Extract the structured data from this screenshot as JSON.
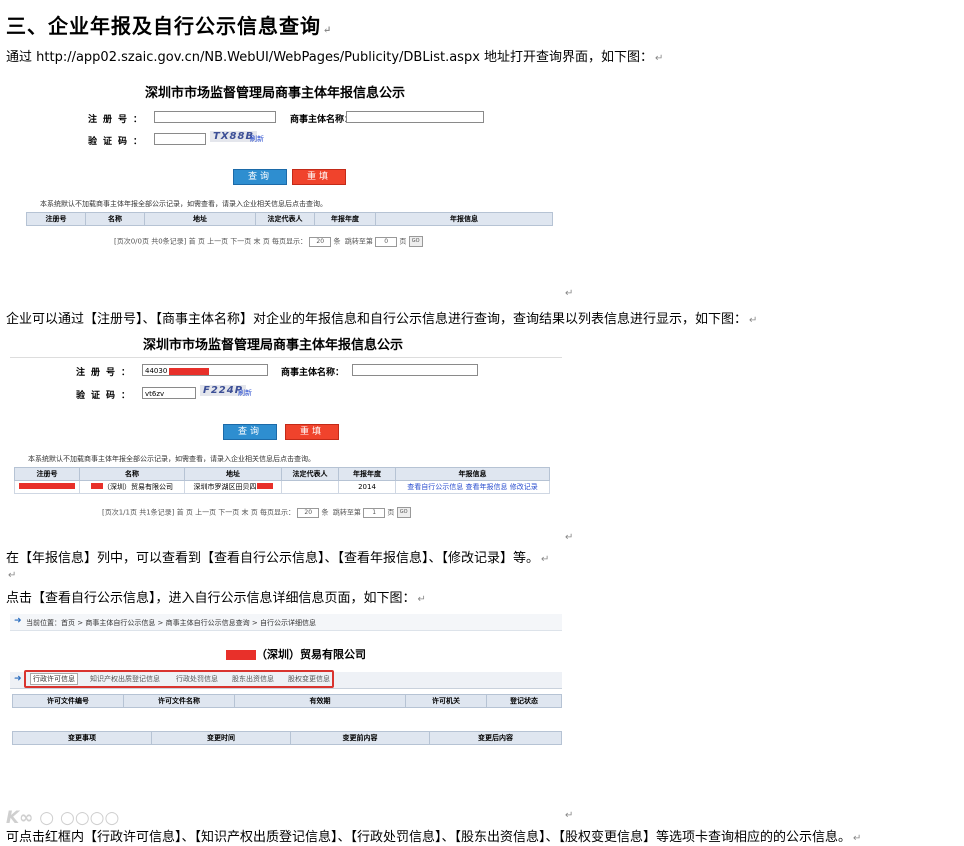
{
  "heading": "三、企业年报及自行公示信息查询",
  "para1": "通过 http://app02.szaic.gov.cn/NB.WebUI/WebPages/Publicity/DBList.aspx 地址打开查询界面，如下图：",
  "para2": "企业可以通过【注册号】、【商事主体名称】对企业的年报信息和自行公示信息进行查询，查询结果以列表信息进行显示，如下图：",
  "para3": "在【年报信息】列中，可以查看到【查看自行公示信息】、【查看年报信息】、【修改记录】等。",
  "para4": "点击【查看自行公示信息】，进入自行公示信息详细信息页面，如下图：",
  "para5": "可点击红框内【行政许可信息】、【知识产权出质登记信息】、【行政处罚信息】、【股东出资信息】、【股权变更信息】等选项卡查询相应的的公示信息。",
  "return_mark": "↵",
  "shot1": {
    "title": "深圳市市场监督管理局商事主体年报信息公示",
    "reg_label": "注册号：",
    "name_label": "商事主体名称：",
    "code_label": "验证码：",
    "captcha": "TX88B",
    "refresh": "刷新",
    "query_btn": "查询",
    "reset_btn": "重填",
    "note": "本系统默认不加载商事主体年报全部公示记录，如需查看，请录入企业相关信息后点击查询。",
    "columns": [
      "注册号",
      "名称",
      "地址",
      "法定代表人",
      "年报年度",
      "年报信息"
    ],
    "pager": "[页次0/0页 共0条记录] 首 页 上一页 下一页 末 页  每页显示：",
    "page_size": "20",
    "per": "条",
    "jump": "跳转至第",
    "page_no": "0",
    "page_unit": "页",
    "go": "GO"
  },
  "shot2": {
    "title": "深圳市市场监督管理局商事主体年报信息公示",
    "reg_label": "注册号：",
    "reg_value": "44030",
    "name_label": "商事主体名称：",
    "code_label": "验证码：",
    "code_value": "vt6zv",
    "captcha": "F224P",
    "refresh": "刷新",
    "query_btn": "查询",
    "reset_btn": "重填",
    "note": "本系统默认不加载商事主体年报全部公示记录，如需查看，请录入企业相关信息后点击查询。",
    "columns": [
      "注册号",
      "名称",
      "地址",
      "法定代表人",
      "年报年度",
      "年报信息"
    ],
    "row": {
      "name": "（深圳）贸易有限公司",
      "address": "深圳市罗湖区田贝四",
      "year": "2014",
      "link1": "查看自行公示信息",
      "link2": "查看年报信息",
      "link3": "修改记录"
    },
    "pager": "[页次1/1页 共1条记录] 首 页 上一页 下一页 末 页  每页显示：",
    "page_size": "20",
    "per": "条",
    "jump": "跳转至第",
    "page_no": "1",
    "page_unit": "页",
    "go": "GO"
  },
  "shot3": {
    "crumb": "当前位置：首页 > 商事主体自行公示信息 > 商事主体自行公示信息查询 > 自行公示详细信息",
    "company": "（深圳）贸易有限公司",
    "tabs": [
      "行政许可信息",
      "知识产权出质登记信息",
      "行政处罚信息",
      "股东出资信息",
      "股权变更信息"
    ],
    "table1_cols": [
      "许可文件编号",
      "许可文件名称",
      "有效期",
      "许可机关",
      "登记状态"
    ],
    "table2_cols": [
      "变更事项",
      "变更时间",
      "变更前内容",
      "变更后内容"
    ]
  },
  "colors": {
    "redact": "#e8302a",
    "query_btn": "#2e8ed0",
    "reset_btn": "#f0432c",
    "tab_box": "#d9342f"
  }
}
